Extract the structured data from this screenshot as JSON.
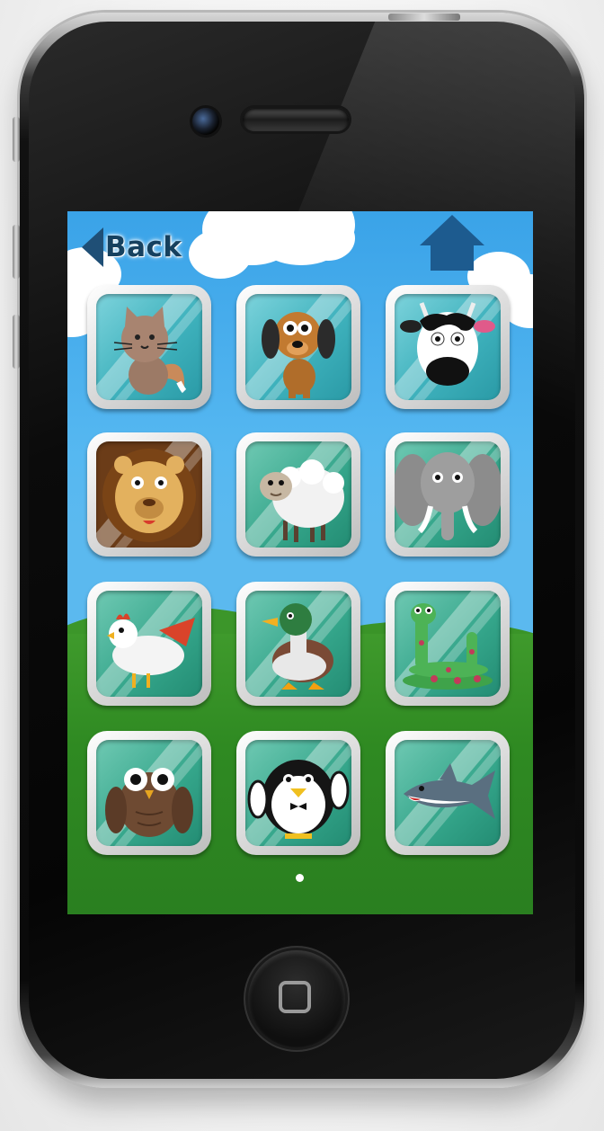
{
  "nav": {
    "back_label": "Back"
  },
  "animals": [
    {
      "name": "cat"
    },
    {
      "name": "dog"
    },
    {
      "name": "cow"
    },
    {
      "name": "lion"
    },
    {
      "name": "sheep"
    },
    {
      "name": "elephant"
    },
    {
      "name": "chicken"
    },
    {
      "name": "duck"
    },
    {
      "name": "snake"
    },
    {
      "name": "owl"
    },
    {
      "name": "penguin"
    },
    {
      "name": "shark"
    }
  ],
  "pagination": {
    "current_page": 1,
    "total_pages": 1
  },
  "colors": {
    "sky": "#56b8f1",
    "grass": "#2f8a22",
    "tile_blue": "#3fb2bd",
    "tile_teal": "#34a58a",
    "nav": "#1d5b8f"
  }
}
